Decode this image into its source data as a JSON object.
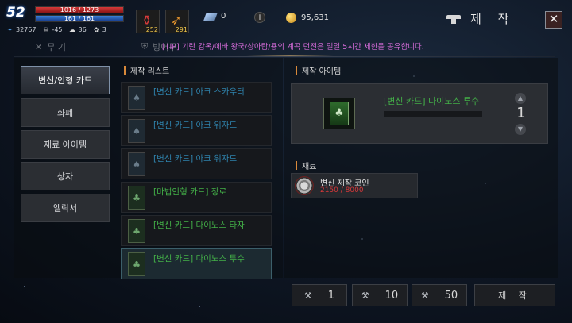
{
  "hud": {
    "level": "52",
    "hp_text": "1016 / 1273",
    "mp_text": "161 / 161",
    "stats": [
      {
        "icon": "exp-icon",
        "value": "32767"
      },
      {
        "icon": "skull-icon",
        "value": "-45"
      },
      {
        "icon": "weight-icon",
        "value": "36"
      },
      {
        "icon": "buff-icon",
        "value": "3"
      }
    ],
    "potions": [
      {
        "icon": "red-potion-icon",
        "count": "252"
      },
      {
        "icon": "haste-potion-icon",
        "count": "291"
      }
    ],
    "gems": "0",
    "gold": "95,631"
  },
  "header": {
    "title": "제 작",
    "close_label": "✕"
  },
  "tip": "[TIP] 기란 감옥/에바 왕국/상아탑/용의 계곡 던전은 일일 5시간 제한을 공유합니다.",
  "top_tabs": [
    {
      "label": "무 기",
      "icon": "sword-icon"
    },
    {
      "label": "방어구",
      "icon": "shield-icon"
    }
  ],
  "side_tabs": [
    {
      "label": "변신/인형 카드",
      "active": true
    },
    {
      "label": "화폐",
      "active": false
    },
    {
      "label": "재료 아이템",
      "active": false
    },
    {
      "label": "상자",
      "active": false
    },
    {
      "label": "엘릭서",
      "active": false
    }
  ],
  "recipe_list_title": "제작 리스트",
  "recipes": [
    {
      "label": "[변신 카드] 아크 스카우터",
      "color": "#2f83ad"
    },
    {
      "label": "[변신 카드] 아크 위자드",
      "color": "#2f83ad"
    },
    {
      "label": "[변신 카드] 아크 위자드",
      "color": "#2f83ad"
    },
    {
      "label": "[마법인형 카드] 장로",
      "color": "#43b048"
    },
    {
      "label": "[변신 카드] 다이노스 타자",
      "color": "#43b048"
    },
    {
      "label": "[변신 카드] 다이노스 투수",
      "color": "#43b048"
    }
  ],
  "craft": {
    "section_title": "제작 아이템",
    "item_name": "[변신 카드] 다이노스 투수",
    "quantity": "1"
  },
  "materials": {
    "section_title": "재료",
    "items": [
      {
        "name": "변신 제작 코인",
        "count": "2150 / 8000"
      }
    ]
  },
  "quantity_buttons": [
    "1",
    "10",
    "50"
  ],
  "craft_button": "제 작"
}
